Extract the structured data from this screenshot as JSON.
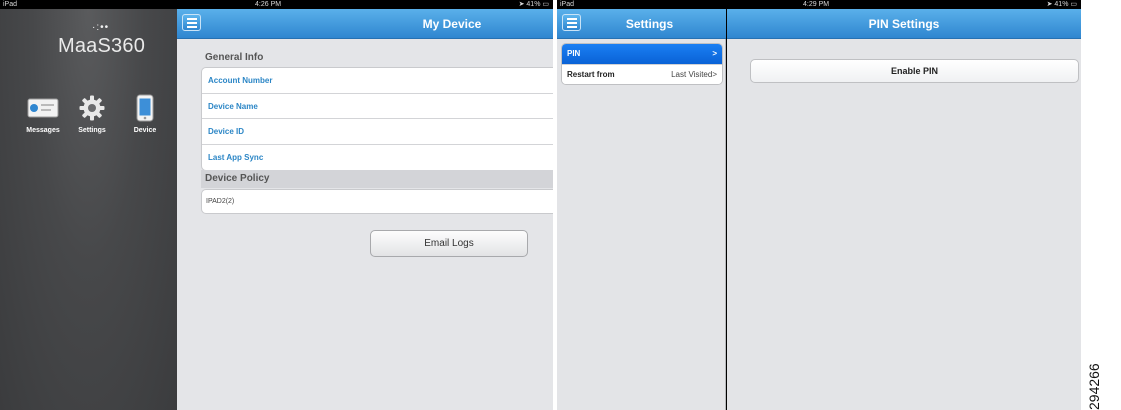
{
  "screen_left": {
    "status_bar": {
      "carrier": "iPad",
      "time": "4:26 PM",
      "battery": "41%"
    },
    "sidebar": {
      "logo_text": "MaaS360",
      "launcher": [
        {
          "label": "Messages",
          "icon": "messages-icon"
        },
        {
          "label": "Settings",
          "icon": "gear-icon"
        },
        {
          "label": "Device",
          "icon": "device-icon"
        }
      ]
    },
    "navbar": {
      "title": "My Device",
      "menu_icon": "menu-icon"
    },
    "general_info": {
      "title": "General Info",
      "rows": [
        "Account Number",
        "Device Name",
        "Device ID",
        "Last App Sync"
      ]
    },
    "device_policy": {
      "title": "Device Policy",
      "value": "IPAD2(2)"
    },
    "email_logs_label": "Email Logs"
  },
  "screen_right": {
    "status_bar": {
      "carrier": "iPad",
      "time": "4:29 PM",
      "battery": "41%"
    },
    "settings_pane": {
      "title": "Settings",
      "rows": [
        {
          "label": "PIN",
          "value": "",
          "chevron": ">"
        },
        {
          "label": "Restart from",
          "value": "Last Visited",
          "chevron": ">"
        }
      ]
    },
    "pin_pane": {
      "title": "PIN Settings",
      "enable_pin_label": "Enable PIN"
    }
  },
  "figure_number": "294266",
  "colors": {
    "accent_blue": "#2f86d0",
    "selected_blue": "#0a62d6",
    "link_blue": "#2b86c6",
    "sidebar_gray": "#47484a"
  }
}
